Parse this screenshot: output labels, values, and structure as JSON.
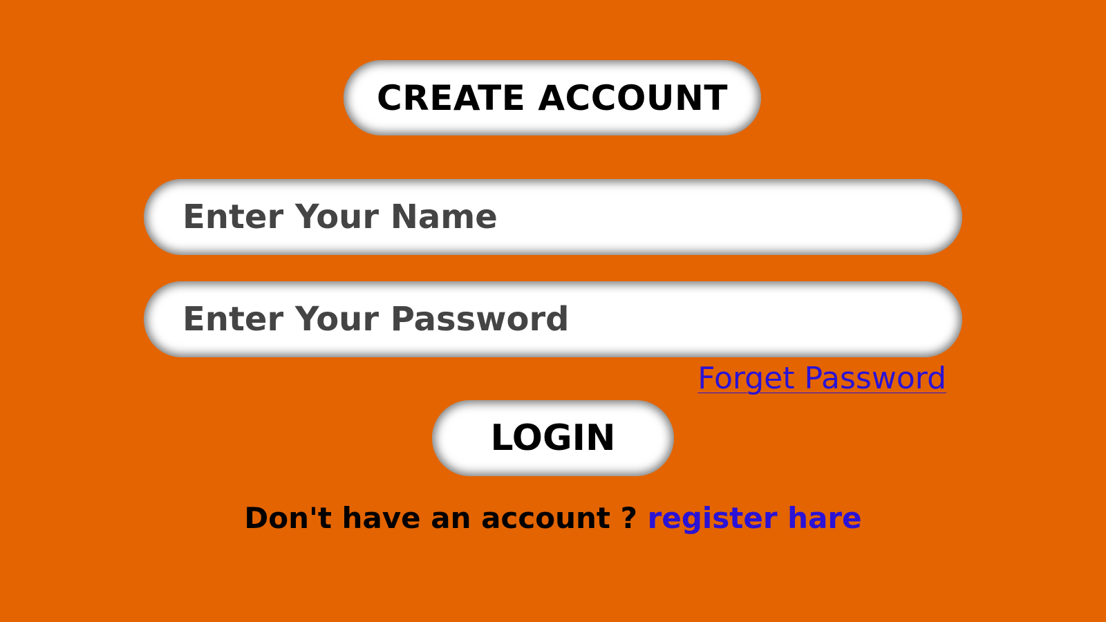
{
  "colors": {
    "background": "#e36401",
    "pill": "#ffffff",
    "link": "#2a12d6",
    "placeholder_text": "#444444"
  },
  "header": {
    "title": "CREATE ACCOUNT"
  },
  "form": {
    "name_field": {
      "placeholder": "Enter Your Name",
      "value": ""
    },
    "password_field": {
      "placeholder": "Enter Your Password",
      "value": ""
    },
    "forget_password_label": "Forget Password",
    "login_label": "LOGIN"
  },
  "footer": {
    "prompt": "Don't have an account ?",
    "register_label": "register hare"
  }
}
